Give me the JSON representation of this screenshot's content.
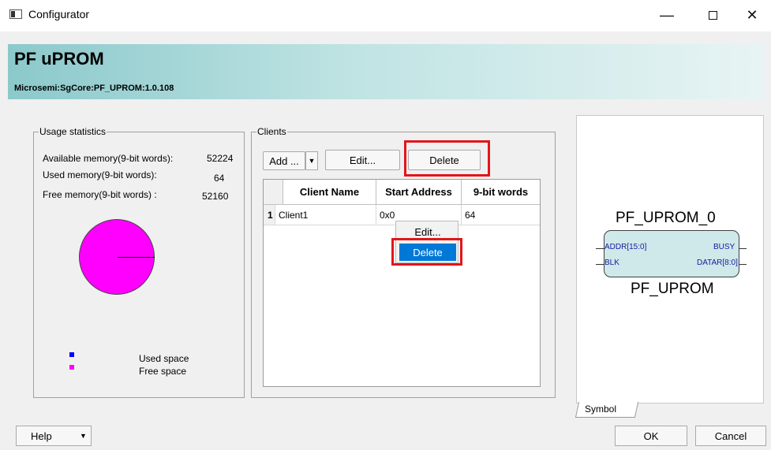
{
  "window": {
    "title": "Configurator",
    "minimize": "—",
    "close": "✕"
  },
  "header": {
    "title": "PF uPROM",
    "subtitle": "Microsemi:SgCore:PF_UPROM:1.0.108"
  },
  "usage": {
    "legend": "Usage statistics",
    "available_label": "Available memory(9-bit words):",
    "available_value": "52224",
    "used_label": "Used memory(9-bit words):",
    "used_value": "64",
    "free_label": "Free memory(9-bit words) :",
    "free_value": "52160",
    "pie_legend_used": "Used space",
    "pie_legend_free": "Free space",
    "colors": {
      "used": "#0000ff",
      "free": "#ff00ff"
    }
  },
  "clients": {
    "legend": "Clients",
    "add_label": "Add ...",
    "edit_label": "Edit...",
    "delete_label": "Delete",
    "columns": [
      "Client Name",
      "Start Address",
      "9-bit words"
    ],
    "rows": [
      {
        "index": "1",
        "name": "Client1",
        "start": "0x0",
        "words": "64"
      }
    ]
  },
  "context_menu": {
    "items": [
      "Edit...",
      "Delete"
    ],
    "selected": "Delete"
  },
  "symbol": {
    "instance": "PF_UPROM_0",
    "type": "PF_UPROM",
    "pins_left": [
      "ADDR[15:0]",
      "BLK"
    ],
    "pins_right": [
      "BUSY",
      "DATAR[8:0]"
    ],
    "tab_label": "Symbol"
  },
  "footer": {
    "help_label": "Help",
    "ok_label": "OK",
    "cancel_label": "Cancel"
  }
}
